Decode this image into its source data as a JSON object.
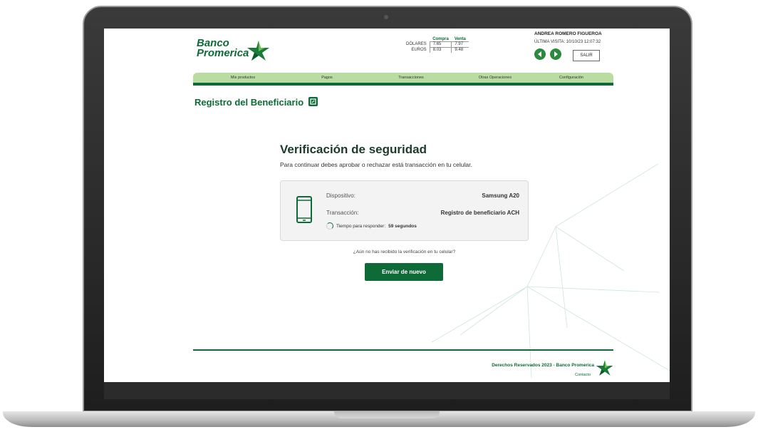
{
  "brand": {
    "line1": "Banco",
    "line2": "Promerica",
    "primary_color": "#0e6b38",
    "tab_color": "#b8dca2"
  },
  "rates": {
    "headers": [
      "Compra",
      "Venta"
    ],
    "rows": [
      {
        "label": "DÓLARES",
        "buy": "7.65",
        "sell": "7.97"
      },
      {
        "label": "EUROS",
        "buy": "8.03",
        "sell": "9.48"
      }
    ]
  },
  "user": {
    "name": "ANDREA ROMERO FIGUEROA",
    "last_visit_label": "ÚLTIMA VISITA:",
    "last_visit_value": "10/10/23 12:07:32",
    "logout_label": "SALIR"
  },
  "tabs": [
    "Mis productos",
    "Pagos",
    "Transacciones",
    "Otras Operaciones",
    "Configuración"
  ],
  "page": {
    "title": "Registro del Beneficiario"
  },
  "verification": {
    "title": "Verificación de seguridad",
    "subtitle": "Para continuar debes aprobar o rechazar está transacción en tu celular.",
    "device_label": "Dispositivo:",
    "device_value": "Samsung A20",
    "transaction_label": "Transacción:",
    "transaction_value": "Registro de beneficiario ACH",
    "timer_label": "Tiempo para responder:",
    "timer_value": "59 segundos",
    "not_received": "¿Aún no has recibido la verificación en tu celular?",
    "resend_label": "Enviar de nuevo"
  },
  "footer": {
    "rights": "Derechos Reservados 2023 - Banco Promerica",
    "contact": "Contacto"
  }
}
